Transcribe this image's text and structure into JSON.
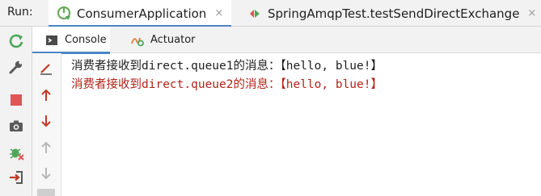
{
  "run_bar": {
    "label": "Run:",
    "tabs": [
      {
        "label": "ConsumerApplication",
        "active": true,
        "icon": "spring-boot-icon",
        "close": "×"
      },
      {
        "label": "SpringAmqpTest.testSendDirectExchange",
        "active": false,
        "icon": "run-test-icon",
        "close": "×"
      }
    ]
  },
  "sub_tabs": {
    "console": "Console",
    "actuator": "Actuator"
  },
  "left_toolbar": [
    "rerun-icon",
    "wrench-icon",
    "stop-icon",
    "camera-icon",
    "debug-exit-icon",
    "login-icon"
  ],
  "gutter_tools": [
    "soft-wrap-icon",
    "arrow-up-icon",
    "arrow-down-icon",
    "scroll-up-icon",
    "scroll-down-icon"
  ],
  "console": {
    "lines": [
      {
        "text": "消费者接收到direct.queue1的消息：【hello, blue!】",
        "style": "normal"
      },
      {
        "text": "消费者接收到direct.queue2的消息：【hello, blue!】",
        "style": "error"
      }
    ]
  },
  "colors": {
    "accent": "#4a86c7",
    "error_text": "#b2241a",
    "stop_red": "#e05555",
    "run_green": "#4fa65a"
  }
}
